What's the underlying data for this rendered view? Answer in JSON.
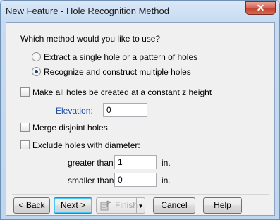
{
  "window": {
    "title": "New Feature - Hole Recognition Method",
    "close_glyph": "✕"
  },
  "method": {
    "question": "Which method would you like to use?",
    "options": [
      {
        "label": "Extract a single hole or a pattern of holes",
        "selected": false
      },
      {
        "label": "Recognize and construct multiple holes",
        "selected": true
      }
    ]
  },
  "constant_z": {
    "label": "Make all holes be created at a constant z height",
    "checked": false,
    "elevation_label": "Elevation:",
    "elevation_value": "0"
  },
  "merge": {
    "label": "Merge disjoint holes",
    "checked": false
  },
  "exclude": {
    "label": "Exclude holes with diameter:",
    "checked": false,
    "greater_label": "greater than",
    "greater_value": "1",
    "greater_unit": "in.",
    "smaller_label": "smaller than",
    "smaller_value": "0",
    "smaller_unit": "in."
  },
  "buttons": {
    "back": "< Back",
    "next": "Next >",
    "finish": "Finish",
    "cancel": "Cancel",
    "help": "Help"
  },
  "colors": {
    "accent_label": "#1f4fa6",
    "close_button": "#c44432"
  }
}
